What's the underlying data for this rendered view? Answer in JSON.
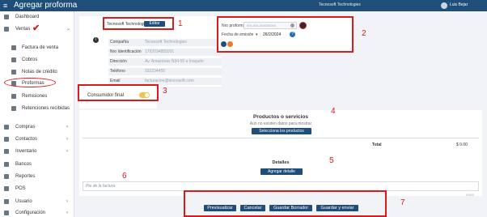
{
  "topbar": {
    "menu_icon": "≡",
    "title": "Agregar proforma",
    "company": "Tecnosoft Technologies",
    "user": "Luis Bejar"
  },
  "sidebar": {
    "items": [
      {
        "label": "Dashboard",
        "icon": "dashboard-icon"
      },
      {
        "label": "Ventas",
        "icon": "cart-icon",
        "chevron": "⌄"
      },
      {
        "label": "Factura de venta",
        "icon": "invoice-icon"
      },
      {
        "label": "Cobros",
        "icon": "money-icon"
      },
      {
        "label": "Notas de crédito",
        "icon": "credit-note-icon"
      },
      {
        "label": "Proformas",
        "icon": "proforma-icon"
      },
      {
        "label": "Remisiones",
        "icon": "truck-icon"
      },
      {
        "label": "Retenciones recibidas",
        "icon": "receipt-icon"
      },
      {
        "label": "Compras",
        "icon": "shopping-bag-icon",
        "chevron": "›"
      },
      {
        "label": "Contactos",
        "icon": "contacts-icon",
        "chevron": "›"
      },
      {
        "label": "Inventario",
        "icon": "box-icon",
        "chevron": "›"
      },
      {
        "label": "Bancos",
        "icon": "bank-icon"
      },
      {
        "label": "Reportes",
        "icon": "report-icon"
      },
      {
        "label": "POS",
        "icon": "pos-icon"
      },
      {
        "label": "Usuario",
        "icon": "user-icon",
        "chevron": "›"
      },
      {
        "label": "Configuración",
        "icon": "settings-icon",
        "chevron": "›"
      }
    ],
    "checkmark": "✔"
  },
  "company_card": {
    "tag": "Tecnosoft Technologies",
    "edit_label": "Editar",
    "info_icon": "i",
    "fields": [
      {
        "label": "Compañía",
        "value": "Tecnosoft Technologies"
      },
      {
        "label": "Nro Identificación",
        "value": "1792034855001"
      },
      {
        "label": "Dirección",
        "value": "Av. Amazonas N34-50 e Inaquito"
      },
      {
        "label": "Teléfono",
        "value": "022234455"
      },
      {
        "label": "Email",
        "value": "facturacion@tecnosoft.com"
      }
    ]
  },
  "proforma_card": {
    "nro_label": "Nro proforma",
    "nro_value": "001-001-000000003",
    "fecha_label": "Fecha de emisión",
    "fecha_value": "26/2/2024",
    "help_icon": "?"
  },
  "consumidor": {
    "label": "Consumidor final",
    "toggle_on": true
  },
  "products": {
    "title": "Productos o servicios",
    "empty_text": "Aún no existen datos para mostrar",
    "select_label": "Selecciona los productos",
    "total_label": "Total",
    "total_value": "$ 0.00"
  },
  "details": {
    "title": "Detalles",
    "add_label": "Agregar detalle",
    "footer_placeholder": "Pie de la factura",
    "counter": "0/500"
  },
  "actions": [
    {
      "label": "Previsualizar"
    },
    {
      "label": "Cancelar"
    },
    {
      "label": "Guardar Borrador"
    },
    {
      "label": "Guardar y enviar"
    }
  ],
  "annotations": [
    "1",
    "2",
    "3",
    "4",
    "5",
    "6",
    "7"
  ],
  "colors": {
    "primary": "#1f4e79",
    "annotation": "#d81b1b",
    "toggle": "#f2c44d"
  }
}
